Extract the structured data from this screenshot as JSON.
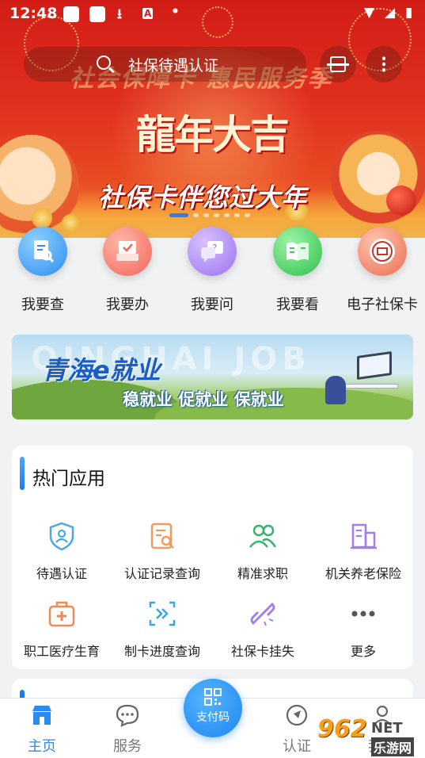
{
  "status_bar": {
    "time": "12:48",
    "download_icon": "download-icon",
    "a_badge": "A",
    "dot": "•"
  },
  "search": {
    "placeholder": "社保待遇认证"
  },
  "hero": {
    "header_text": "社会保障卡 惠民服务季",
    "calligraphy": "龍年大吉",
    "slogan": "社保卡伴您过大年",
    "page_count": 7,
    "active_page": 1
  },
  "services": [
    {
      "label": "我要查",
      "icon": "document-search-icon",
      "color": "#2d8df0"
    },
    {
      "label": "我要办",
      "icon": "checkbox-tray-icon",
      "color": "#f2655c"
    },
    {
      "label": "我要问",
      "icon": "question-chat-icon",
      "color": "#9a74ee"
    },
    {
      "label": "我要看",
      "icon": "open-book-icon",
      "color": "#2cc14a"
    },
    {
      "label": "电子社保卡",
      "icon": "social-security-emblem-icon",
      "color": "#ec6d52"
    }
  ],
  "promo": {
    "watermark": "QINGHAI JOB",
    "title": "青海e就业",
    "subtitle": "稳就业 促就业 保就业"
  },
  "hot_apps": {
    "title": "热门应用",
    "items": [
      {
        "label": "待遇认证",
        "icon": "shield-person-icon"
      },
      {
        "label": "认证记录查询",
        "icon": "record-search-icon"
      },
      {
        "label": "精准求职",
        "icon": "people-icon"
      },
      {
        "label": "机关养老保险",
        "icon": "building-icon"
      },
      {
        "label": "职工医疗生育",
        "icon": "medical-kit-icon"
      },
      {
        "label": "制卡进度查询",
        "icon": "card-progress-icon"
      },
      {
        "label": "社保卡挂失",
        "icon": "broken-link-icon"
      },
      {
        "label": "更多",
        "icon": "more-dots-icon"
      }
    ]
  },
  "bottom_nav": {
    "home": "主页",
    "services": "服务",
    "pay": "支付码",
    "auth": "认证",
    "mine": "我的"
  },
  "watermark_logo": {
    "number": "962",
    "net": "NET",
    "name": "乐游网"
  },
  "colors": {
    "primary": "#1d84ef",
    "active_nav": "#2a8bf2",
    "hero_red": "#d21d17"
  }
}
